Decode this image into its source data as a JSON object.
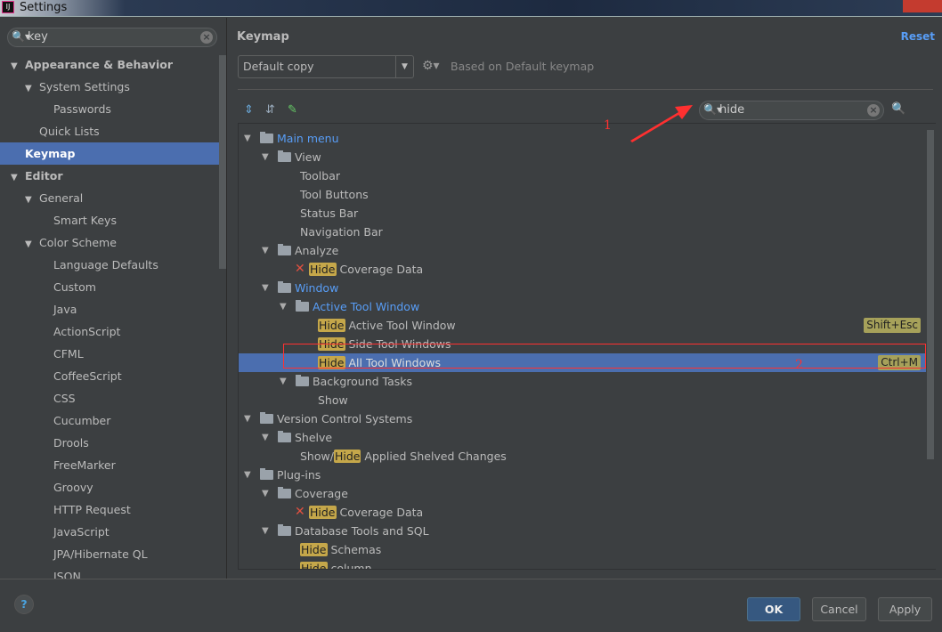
{
  "window": {
    "title": "Settings"
  },
  "sidebar": {
    "search": {
      "value": "key"
    },
    "items": [
      {
        "label": "Appearance & Behavior",
        "level": 0,
        "expand": true,
        "bold": true
      },
      {
        "label": "System Settings",
        "level": 1,
        "expand": true
      },
      {
        "label": "Passwords",
        "level": 2
      },
      {
        "label": "Quick Lists",
        "level": 1
      },
      {
        "label": "Keymap",
        "level": 0,
        "bold": true,
        "selected": true
      },
      {
        "label": "Editor",
        "level": 0,
        "expand": true,
        "bold": true
      },
      {
        "label": "General",
        "level": 1,
        "expand": true
      },
      {
        "label": "Smart Keys",
        "level": 2
      },
      {
        "label": "Color Scheme",
        "level": 1,
        "expand": true
      },
      {
        "label": "Language Defaults",
        "level": 2
      },
      {
        "label": "Custom",
        "level": 2
      },
      {
        "label": "Java",
        "level": 2
      },
      {
        "label": "ActionScript",
        "level": 2
      },
      {
        "label": "CFML",
        "level": 2
      },
      {
        "label": "CoffeeScript",
        "level": 2
      },
      {
        "label": "CSS",
        "level": 2
      },
      {
        "label": "Cucumber",
        "level": 2
      },
      {
        "label": "Drools",
        "level": 2
      },
      {
        "label": "FreeMarker",
        "level": 2
      },
      {
        "label": "Groovy",
        "level": 2
      },
      {
        "label": "HTTP Request",
        "level": 2
      },
      {
        "label": "JavaScript",
        "level": 2
      },
      {
        "label": "JPA/Hibernate QL",
        "level": 2
      },
      {
        "label": "JSON",
        "level": 2
      }
    ]
  },
  "main": {
    "title": "Keymap",
    "reset": "Reset",
    "keymap_select": "Default copy",
    "based_on": "Based on Default keymap",
    "filter": {
      "value": "hide"
    },
    "tree": [
      {
        "level": 0,
        "expand": true,
        "folder": true,
        "text": "Main menu",
        "blue": true,
        "icon": "menu-folder-icon"
      },
      {
        "level": 1,
        "expand": true,
        "folder": true,
        "text": "View"
      },
      {
        "level": 2,
        "text": "Toolbar"
      },
      {
        "level": 2,
        "text": "Tool Buttons"
      },
      {
        "level": 2,
        "text": "Status Bar"
      },
      {
        "level": 2,
        "text": "Navigation Bar"
      },
      {
        "level": 1,
        "expand": true,
        "folder": true,
        "text": "Analyze"
      },
      {
        "level": 2,
        "x": true,
        "hl": "Hide",
        "text": " Coverage Data"
      },
      {
        "level": 1,
        "expand": true,
        "folder": true,
        "text": "Window",
        "blue": true
      },
      {
        "level": 2,
        "expand": true,
        "folder": true,
        "text": "Active Tool Window",
        "blue": true
      },
      {
        "level": 3,
        "hl": "Hide",
        "text": " Active Tool Window",
        "shortcut": "Shift+Esc"
      },
      {
        "level": 3,
        "hl": "Hide",
        "text": " Side Tool Windows"
      },
      {
        "level": 3,
        "hl": "Hide",
        "text": " All Tool Windows",
        "shortcut": "Ctrl+M",
        "selected": true
      },
      {
        "level": 2,
        "expand": true,
        "folder": true,
        "text": "Background Tasks"
      },
      {
        "level": 3,
        "text": "Show"
      },
      {
        "level": 0,
        "expand": true,
        "folder": true,
        "text": "Version Control Systems"
      },
      {
        "level": 1,
        "expand": true,
        "folder": true,
        "text": "Shelve"
      },
      {
        "level": 2,
        "pre": "Show/",
        "hl": "Hide",
        "text": " Applied Shelved Changes"
      },
      {
        "level": 0,
        "expand": true,
        "folder": true,
        "text": "Plug-ins"
      },
      {
        "level": 1,
        "expand": true,
        "folder": true,
        "text": "Coverage"
      },
      {
        "level": 2,
        "x": true,
        "hl": "Hide",
        "text": " Coverage Data"
      },
      {
        "level": 1,
        "expand": true,
        "folder": true,
        "text": "Database Tools and SQL"
      },
      {
        "level": 2,
        "hl": "Hide",
        "text": " Schemas"
      },
      {
        "level": 2,
        "hl": "Hide",
        "text": " column"
      }
    ]
  },
  "annotations": {
    "one": "1",
    "two": "2"
  },
  "footer": {
    "ok": "OK",
    "cancel": "Cancel",
    "apply": "Apply"
  },
  "colors": {
    "accent": "#4b6eaf",
    "link": "#589df6",
    "highlight": "#c5a74a",
    "annotation": "#ff3030"
  }
}
